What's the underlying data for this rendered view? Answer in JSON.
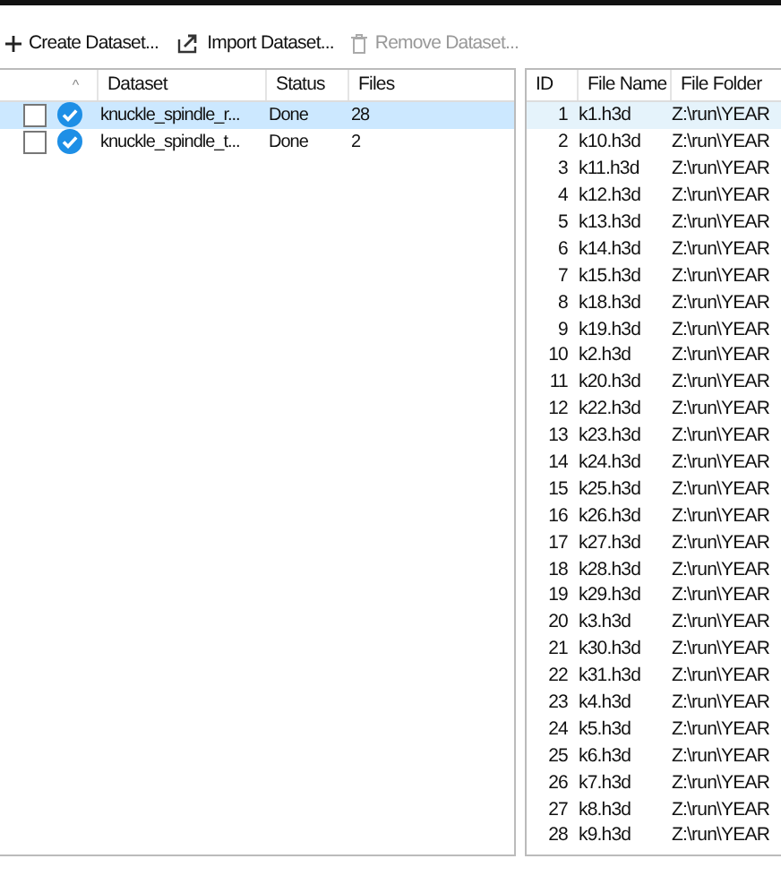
{
  "toolbar": [
    {
      "label": "Create Dataset...",
      "kind": "plus",
      "disabled": false
    },
    {
      "label": "Import Dataset...",
      "kind": "import",
      "disabled": false
    },
    {
      "label": "Remove Dataset...",
      "kind": "trash",
      "disabled": true
    }
  ],
  "datasets": {
    "columns": [
      "Dataset",
      "Status",
      "Files"
    ],
    "sort_indicator": "^",
    "rows": [
      {
        "checked": false,
        "dataset": "knuckle_spindle_r...",
        "status": "Done",
        "files": "28",
        "selected": true
      },
      {
        "checked": false,
        "dataset": "knuckle_spindle_t...",
        "status": "Done",
        "files": "2",
        "selected": false
      }
    ]
  },
  "files": {
    "columns": [
      "ID",
      "File Name",
      "File Folder"
    ],
    "rows": [
      {
        "id": "1",
        "name": "k1.h3d",
        "folder": "Z:\\run\\YEAR",
        "selected": true
      },
      {
        "id": "2",
        "name": "k10.h3d",
        "folder": "Z:\\run\\YEAR",
        "selected": false
      },
      {
        "id": "3",
        "name": "k11.h3d",
        "folder": "Z:\\run\\YEAR",
        "selected": false
      },
      {
        "id": "4",
        "name": "k12.h3d",
        "folder": "Z:\\run\\YEAR",
        "selected": false
      },
      {
        "id": "5",
        "name": "k13.h3d",
        "folder": "Z:\\run\\YEAR",
        "selected": false
      },
      {
        "id": "6",
        "name": "k14.h3d",
        "folder": "Z:\\run\\YEAR",
        "selected": false
      },
      {
        "id": "7",
        "name": "k15.h3d",
        "folder": "Z:\\run\\YEAR",
        "selected": false
      },
      {
        "id": "8",
        "name": "k18.h3d",
        "folder": "Z:\\run\\YEAR",
        "selected": false
      },
      {
        "id": "9",
        "name": "k19.h3d",
        "folder": "Z:\\run\\YEAR",
        "selected": false
      },
      {
        "id": "10",
        "name": "k2.h3d",
        "folder": "Z:\\run\\YEAR",
        "selected": false
      },
      {
        "id": "11",
        "name": "k20.h3d",
        "folder": "Z:\\run\\YEAR",
        "selected": false
      },
      {
        "id": "12",
        "name": "k22.h3d",
        "folder": "Z:\\run\\YEAR",
        "selected": false
      },
      {
        "id": "13",
        "name": "k23.h3d",
        "folder": "Z:\\run\\YEAR",
        "selected": false
      },
      {
        "id": "14",
        "name": "k24.h3d",
        "folder": "Z:\\run\\YEAR",
        "selected": false
      },
      {
        "id": "15",
        "name": "k25.h3d",
        "folder": "Z:\\run\\YEAR",
        "selected": false
      },
      {
        "id": "16",
        "name": "k26.h3d",
        "folder": "Z:\\run\\YEAR",
        "selected": false
      },
      {
        "id": "17",
        "name": "k27.h3d",
        "folder": "Z:\\run\\YEAR",
        "selected": false
      },
      {
        "id": "18",
        "name": "k28.h3d",
        "folder": "Z:\\run\\YEAR",
        "selected": false
      },
      {
        "id": "19",
        "name": "k29.h3d",
        "folder": "Z:\\run\\YEAR",
        "selected": false
      },
      {
        "id": "20",
        "name": "k3.h3d",
        "folder": "Z:\\run\\YEAR",
        "selected": false
      },
      {
        "id": "21",
        "name": "k30.h3d",
        "folder": "Z:\\run\\YEAR",
        "selected": false
      },
      {
        "id": "22",
        "name": "k31.h3d",
        "folder": "Z:\\run\\YEAR",
        "selected": false
      },
      {
        "id": "23",
        "name": "k4.h3d",
        "folder": "Z:\\run\\YEAR",
        "selected": false
      },
      {
        "id": "24",
        "name": "k5.h3d",
        "folder": "Z:\\run\\YEAR",
        "selected": false
      },
      {
        "id": "25",
        "name": "k6.h3d",
        "folder": "Z:\\run\\YEAR",
        "selected": false
      },
      {
        "id": "26",
        "name": "k7.h3d",
        "folder": "Z:\\run\\YEAR",
        "selected": false
      },
      {
        "id": "27",
        "name": "k8.h3d",
        "folder": "Z:\\run\\YEAR",
        "selected": false
      },
      {
        "id": "28",
        "name": "k9.h3d",
        "folder": "Z:\\run\\YEAR",
        "selected": false
      }
    ]
  }
}
